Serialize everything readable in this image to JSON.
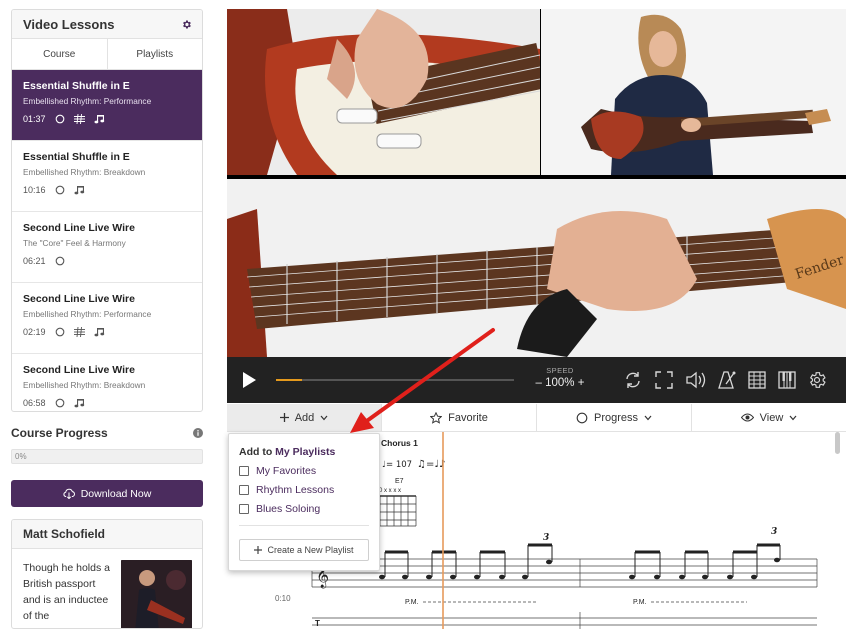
{
  "sidebar": {
    "title": "Video Lessons",
    "tabs": [
      {
        "label": "Course"
      },
      {
        "label": "Playlists"
      }
    ],
    "lessons": [
      {
        "title": "Essential Shuffle in E",
        "subtitle": "Embellished Rhythm: Performance",
        "duration": "01:37",
        "icons": [
          "progress-circle-icon",
          "tab-icon",
          "notation-icon"
        ],
        "active": true
      },
      {
        "title": "Essential Shuffle in E",
        "subtitle": "Embellished Rhythm: Breakdown",
        "duration": "10:16",
        "icons": [
          "progress-circle-icon",
          "notation-icon"
        ],
        "active": false
      },
      {
        "title": "Second Line Live Wire",
        "subtitle": "The \"Core\" Feel & Harmony",
        "duration": "06:21",
        "icons": [
          "progress-circle-icon"
        ],
        "active": false
      },
      {
        "title": "Second Line Live Wire",
        "subtitle": "Embellished Rhythm: Performance",
        "duration": "02:19",
        "icons": [
          "progress-circle-icon",
          "tab-icon",
          "notation-icon"
        ],
        "active": false
      },
      {
        "title": "Second Line Live Wire",
        "subtitle": "Embellished Rhythm: Breakdown",
        "duration": "06:58",
        "icons": [
          "progress-circle-icon",
          "notation-icon"
        ],
        "active": false
      }
    ]
  },
  "course_progress": {
    "title": "Course Progress",
    "percent_label": "0%",
    "value": 0
  },
  "download": {
    "label": "Download Now"
  },
  "instructor": {
    "name": "Matt Schofield",
    "bio": "Though he holds a British passport and is an inductee of the"
  },
  "player": {
    "speed_label": "SPEED",
    "speed_value": "– 100% +",
    "playback_progress": 0.11,
    "icons": [
      "loop-icon",
      "fullscreen-icon",
      "volume-icon",
      "metronome-icon",
      "tab-grid-icon",
      "piano-icon",
      "settings-icon"
    ]
  },
  "actions": [
    {
      "label": "Add",
      "icon": "plus-icon"
    },
    {
      "label": "Favorite",
      "icon": "star-icon"
    },
    {
      "label": "Progress",
      "icon": "circle-icon"
    },
    {
      "label": "View",
      "icon": "eye-icon"
    }
  ],
  "dropdown": {
    "title_prefix": "Add to",
    "title_highlight": "My Playlists",
    "items": [
      "My Favorites",
      "Rhythm Lessons",
      "Blues Soloing"
    ],
    "create_label": "Create a New Playlist"
  },
  "notation": {
    "section": "Chorus 1",
    "tempo": "♩= 107",
    "chord": "E7",
    "chord_strings": "0  x x x x",
    "triplet": "3",
    "pm": "P.M.",
    "time": "0:10"
  },
  "colors": {
    "accent": "#4b2c5e",
    "progress": "#e59a1d",
    "arrow": "#e0201b"
  }
}
